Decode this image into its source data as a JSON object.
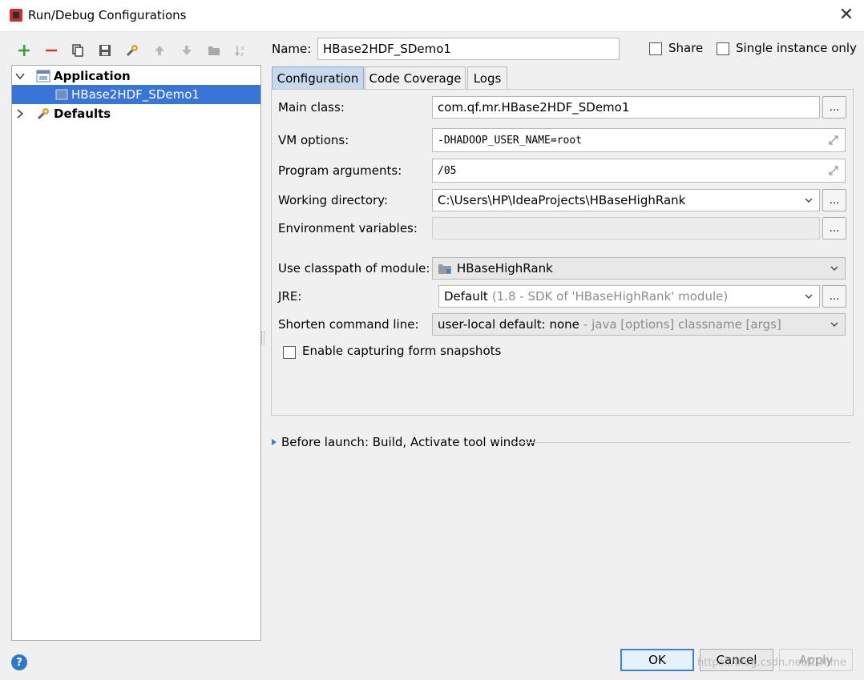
{
  "window": {
    "title": "Run/Debug Configurations",
    "close_glyph": "✕"
  },
  "toolbar": {
    "icons": [
      "add-icon",
      "remove-icon",
      "copy-icon",
      "save-icon",
      "wrench-icon",
      "move-up-icon",
      "move-down-icon",
      "folder-icon",
      "sort-icon"
    ]
  },
  "tree": {
    "application_label": "Application",
    "config_label": "HBase2HDF_SDemo1",
    "defaults_label": "Defaults"
  },
  "header": {
    "name_label": "Name:",
    "name_value": "HBase2HDF_SDemo1",
    "share_label": "Share",
    "single_instance_label": "Single instance only"
  },
  "tabs": [
    {
      "label": "Configuration",
      "active": true
    },
    {
      "label": "Code Coverage",
      "active": false
    },
    {
      "label": "Logs",
      "active": false
    }
  ],
  "form": {
    "main_class_label": "Main class:",
    "main_class_value": "com.qf.mr.HBase2HDF_SDemo1",
    "vm_options_label": "VM options:",
    "vm_options_value": "-DHADOOP_USER_NAME=root",
    "program_args_label": "Program arguments:",
    "program_args_value": "/05",
    "working_dir_label": "Working directory:",
    "working_dir_value": "C:\\Users\\HP\\IdeaProjects\\HBaseHighRank",
    "env_vars_label": "Environment variables:",
    "env_vars_value": "",
    "classpath_label": "Use classpath of module:",
    "classpath_value": "HBaseHighRank",
    "jre_label": "JRE:",
    "jre_value": "Default",
    "jre_detail": "(1.8 - SDK of 'HBaseHighRank' module)",
    "shorten_label": "Shorten command line:",
    "shorten_value": "user-local default: none",
    "shorten_detail": "- java [options] classname [args]",
    "snapshot_label": "Enable capturing form snapshots",
    "dots": "..."
  },
  "before_launch": {
    "label": "Before launch: Build, Activate tool window"
  },
  "buttons": {
    "ok": "OK",
    "cancel": "Cancel",
    "apply": "Apply",
    "help": "?"
  },
  "watermark": "https://blog.csdn.net/CDlime"
}
